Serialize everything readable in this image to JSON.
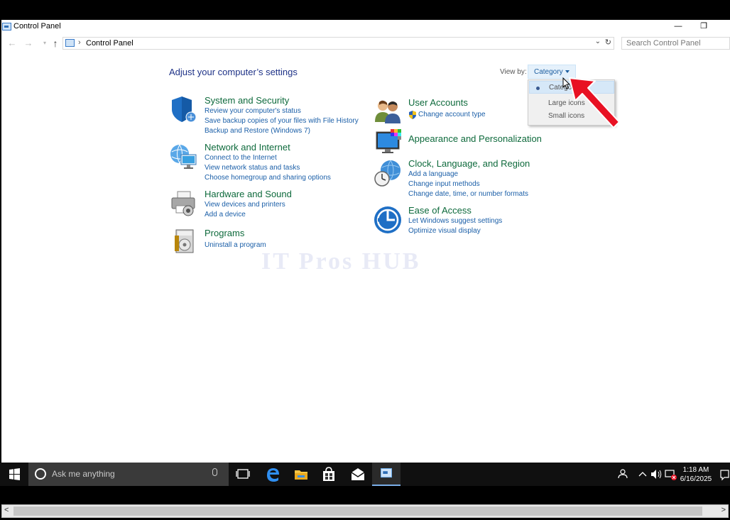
{
  "window": {
    "title": "Control Panel",
    "minimize": "—",
    "restore": "❐"
  },
  "nav": {
    "back": "←",
    "forward": "→",
    "recent": "▾",
    "up": "↑",
    "breadcrumb_sep": "›",
    "path": "Control Panel",
    "dropdown": "⌄",
    "refresh": "↻",
    "search_placeholder": "Search Control Panel"
  },
  "main": {
    "heading": "Adjust your computer’s settings",
    "view_by_label": "View by:",
    "view_by_value": "Category",
    "view_menu": [
      "Category",
      "Large icons",
      "Small icons"
    ],
    "view_menu_selected_visible": "Categor"
  },
  "categories": {
    "system": {
      "title": "System and Security",
      "links": [
        "Review your computer's status",
        "Save backup copies of your files with File History",
        "Backup and Restore (Windows 7)"
      ]
    },
    "network": {
      "title": "Network and Internet",
      "links": [
        "Connect to the Internet",
        "View network status and tasks",
        "Choose homegroup and sharing options"
      ]
    },
    "hardware": {
      "title": "Hardware and Sound",
      "links": [
        "View devices and printers",
        "Add a device"
      ]
    },
    "programs": {
      "title": "Programs",
      "links": [
        "Uninstall a program"
      ]
    },
    "users": {
      "title": "User Accounts",
      "links": [
        "Change account type"
      ]
    },
    "appearance": {
      "title": "Appearance and Personalization",
      "links": []
    },
    "clock": {
      "title": "Clock, Language, and Region",
      "links": [
        "Add a language",
        "Change input methods",
        "Change date, time, or number formats"
      ]
    },
    "ease": {
      "title": "Ease of Access",
      "links": [
        "Let Windows suggest settings",
        "Optimize visual display"
      ]
    }
  },
  "watermark": "IT Pros HUB",
  "taskbar": {
    "search_placeholder": "Ask me anything",
    "time": "1:18 AM",
    "date": "6/16/2025"
  },
  "scrollbar": {
    "left": "<",
    "right": ">"
  },
  "colors": {
    "link": "#1b5fa8",
    "category_title": "#0e6a3c",
    "heading": "#1e3287",
    "annotation_arrow": "#e81123"
  }
}
